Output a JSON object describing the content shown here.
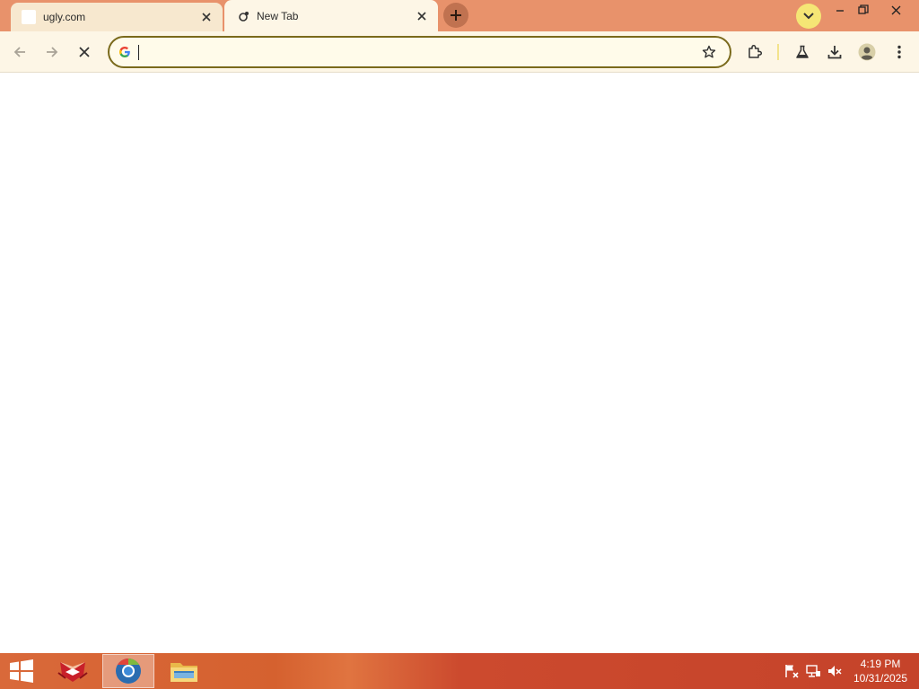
{
  "browser": {
    "tabs": [
      {
        "title": "ugly.com",
        "active": false
      },
      {
        "title": "New Tab",
        "active": true
      }
    ],
    "omnibox": {
      "value": "",
      "placeholder": ""
    },
    "colors": {
      "frame": "#e8926b",
      "toolbar": "#fdf6e6",
      "accent": "#7a6a1c"
    }
  },
  "icons": {
    "back": "arrow-left-icon",
    "forward": "arrow-right-icon",
    "stop": "close-icon",
    "search_engine": "google-g-icon",
    "bookmark": "star-icon",
    "extensions": "puzzle-icon",
    "labs": "flask-icon",
    "downloads": "download-icon",
    "profile": "avatar-icon",
    "menu": "kebab-menu-icon"
  },
  "taskbar": {
    "clock": {
      "time": "4:19 PM",
      "date": "10/31/2025"
    }
  }
}
